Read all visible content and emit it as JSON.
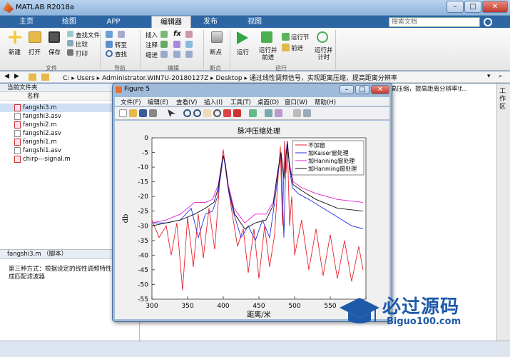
{
  "app": {
    "title": "MATLAB R2018a",
    "search_placeholder": "搜索文档"
  },
  "tabs": [
    "主页",
    "绘图",
    "APP",
    "编辑器",
    "发布",
    "视图"
  ],
  "ribbon": {
    "file": {
      "new": "新建",
      "open": "打开",
      "save": "保存",
      "find": "查找文件",
      "compare": "比较",
      "print": "打印",
      "group": "文件"
    },
    "nav": {
      "goto": "转至",
      "find": "查找",
      "group": "导航"
    },
    "edit": {
      "insert": "插入",
      "comment": "注释",
      "indent": "缩进",
      "fx": "fx",
      "group": "编辑"
    },
    "breakpoints": {
      "label": "断点",
      "group": "断点"
    },
    "run": {
      "run": "运行",
      "run_advance": "运行并\n前进",
      "run_section": "运行节",
      "advance": "前进",
      "run_time": "运行并\n计时",
      "group": "运行"
    }
  },
  "address": {
    "segments": [
      "C:",
      "Users",
      "Administrator.WIN7U-20180127Z",
      "Desktop",
      "通过线性调频信号，实现距离压缩，提高距离分辨率"
    ]
  },
  "left": {
    "header": "当前文件夹",
    "col": "名称",
    "files": [
      {
        "name": "fangshi3.m",
        "type": "m",
        "selected": true
      },
      {
        "name": "fangshi3.asv",
        "type": "asv",
        "selected": false
      },
      {
        "name": "fangshi2.m",
        "type": "m",
        "selected": false
      },
      {
        "name": "fangshi2.asv",
        "type": "asv",
        "selected": false
      },
      {
        "name": "fangshi1.m",
        "type": "m",
        "selected": false
      },
      {
        "name": "fangshi1.asv",
        "type": "asv",
        "selected": false
      },
      {
        "name": "chirp---signal.m",
        "type": "m",
        "selected": false
      }
    ]
  },
  "details": {
    "title": "fangshi3.m （脚本）",
    "text": "第三种方式：根据设定的线性调频特性频域生成匹配滤波器"
  },
  "editor_tab": "高压缩，提高距离分辨率\\f...",
  "workspace_label": "工作区",
  "figure": {
    "title": "Figure 5",
    "menu": [
      "文件(F)",
      "编辑(E)",
      "查看(V)",
      "插入(I)",
      "工具(T)",
      "桌面(D)",
      "窗口(W)",
      "帮助(H)"
    ]
  },
  "watermark": {
    "brand": "必过源码",
    "url": "Biguo100.com"
  },
  "chart_data": {
    "type": "line",
    "title": "脉冲压缩处理",
    "xlabel": "距离/米",
    "ylabel": "db",
    "xlim": [
      300,
      600
    ],
    "ylim": [
      -55,
      0
    ],
    "xticks": [
      300,
      350,
      400,
      450,
      500,
      550,
      600
    ],
    "yticks": [
      0,
      -5,
      -10,
      -15,
      -20,
      -25,
      -30,
      -35,
      -40,
      -45,
      -50,
      -55
    ],
    "legend_position": "top-right",
    "series": [
      {
        "name": "不加窗",
        "color": "#e8222a",
        "x": [
          300,
          310,
          320,
          327,
          335,
          343,
          350,
          358,
          365,
          372,
          380,
          388,
          395,
          400,
          405,
          412,
          420,
          428,
          435,
          443,
          450,
          458,
          465,
          472,
          477,
          480,
          483,
          486,
          488,
          490,
          493,
          496,
          500,
          510,
          520,
          530,
          540,
          550,
          560,
          570,
          580,
          590,
          596
        ],
        "y": [
          -28,
          -34,
          -30,
          -40,
          -29,
          -52,
          -27,
          -44,
          -26,
          -41,
          -24,
          -38,
          -15,
          -4,
          -14,
          -25,
          -37,
          -31,
          -46,
          -31,
          -48,
          -30,
          -44,
          -33,
          -13,
          -3,
          -30,
          -1,
          -12,
          -3,
          -30,
          -20,
          -40,
          -28,
          -45,
          -31,
          -47,
          -33,
          -48,
          -35,
          -49,
          -37,
          -45
        ]
      },
      {
        "name": "加Kaiser窗处理",
        "color": "#2030e0",
        "x": [
          300,
          320,
          340,
          355,
          365,
          375,
          385,
          392,
          397,
          400,
          403,
          408,
          415,
          425,
          435,
          445,
          455,
          465,
          472,
          477,
          481,
          485,
          488,
          490,
          493,
          497,
          505,
          520,
          540,
          560,
          580,
          596
        ],
        "y": [
          -29,
          -29,
          -28,
          -24,
          -34,
          -26,
          -25,
          -20,
          -12,
          -6,
          -10,
          -19,
          -26,
          -34,
          -30,
          -35,
          -28,
          -34,
          -22,
          -12,
          -5,
          -34,
          -5,
          -1,
          -11,
          -17,
          -19,
          -21,
          -24,
          -27,
          -30,
          -31
        ]
      },
      {
        "name": "加Hanning窗处理",
        "color": "#e020d0",
        "x": [
          300,
          320,
          340,
          360,
          375,
          385,
          393,
          397,
          400,
          403,
          407,
          415,
          430,
          445,
          460,
          470,
          476,
          481,
          485,
          487,
          490,
          493,
          498,
          510,
          530,
          560,
          596
        ],
        "y": [
          -29,
          -28,
          -26,
          -22,
          -22,
          -21,
          -16,
          -10,
          -6,
          -9,
          -16,
          -24,
          -29,
          -26,
          -26,
          -22,
          -12,
          -5,
          -13,
          -7,
          -2,
          -9,
          -15,
          -17,
          -19,
          -21,
          -22
        ]
      },
      {
        "name": "加Hanming窗处理",
        "color": "#111111",
        "x": [
          300,
          320,
          340,
          360,
          375,
          387,
          393,
          397,
          400,
          403,
          407,
          416,
          430,
          445,
          460,
          470,
          476,
          481,
          485,
          487,
          490,
          493,
          498,
          510,
          530,
          560,
          596
        ],
        "y": [
          -30,
          -29,
          -28,
          -26,
          -24,
          -22,
          -17,
          -10,
          -6,
          -9,
          -17,
          -26,
          -31,
          -29,
          -28,
          -23,
          -12,
          -5,
          -14,
          -8,
          -2,
          -10,
          -16,
          -18,
          -21,
          -24,
          -25
        ]
      }
    ]
  }
}
